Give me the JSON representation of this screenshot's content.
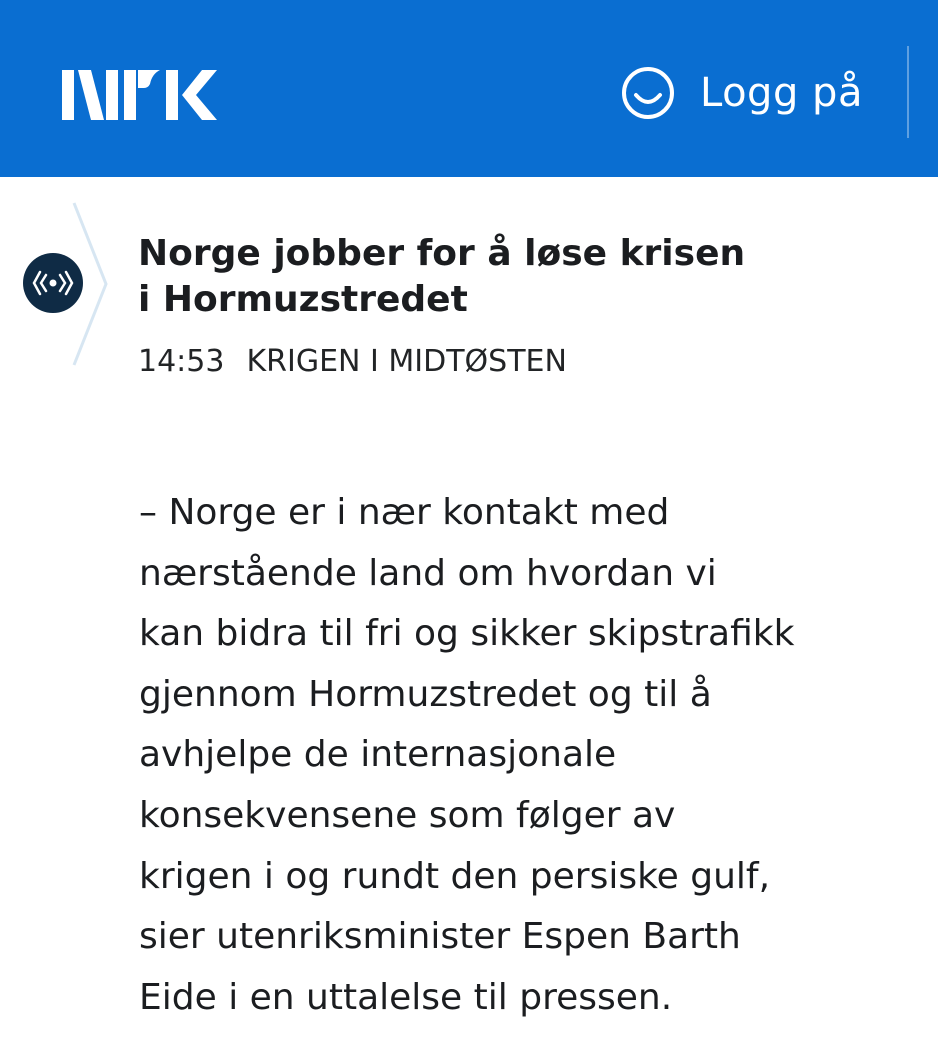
{
  "header": {
    "logo_text": "NRK",
    "login_label": "Logg på",
    "background_color": "#0a6ed1",
    "login_icon": "smiley-user-icon"
  },
  "teaser": {
    "badge_icon": "live-broadcast-icon",
    "title_line1": "Norge jobber for å løse krisen",
    "title_line2": "i Hormuzstredet",
    "time": "14:53",
    "category": "KRIGEN I MIDTØSTEN"
  },
  "quote": {
    "lines": [
      "– Norge er i nær kontakt med",
      "nærstående land om hvordan vi",
      "kan bidra til fri og sikker skipstrafikk",
      "gjennom Hormuzstredet og til å",
      "avhjelpe de internasjonale",
      "konsekvensene som følger av",
      "krigen i og rundt den persiske gulf,",
      "sier utenriksminister Espen Barth",
      "Eide i en uttalelse til pressen."
    ]
  }
}
